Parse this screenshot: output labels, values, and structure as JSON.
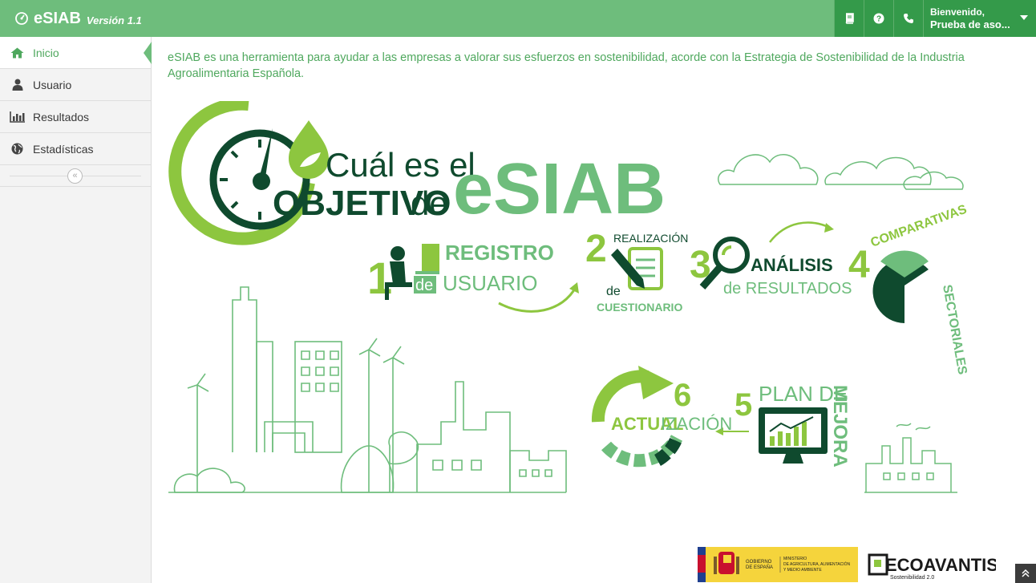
{
  "app": {
    "name": "eSIAB",
    "version": "Versión 1.1"
  },
  "header": {
    "welcome": "Bienvenido,",
    "user": "Prueba de aso...",
    "icons": [
      "book-icon",
      "help-icon",
      "phone-icon"
    ]
  },
  "sidebar": {
    "items": [
      {
        "label": "Inicio",
        "icon": "home-icon",
        "active": true
      },
      {
        "label": "Usuario",
        "icon": "user-icon",
        "active": false
      },
      {
        "label": "Resultados",
        "icon": "bar-chart-icon",
        "active": false
      },
      {
        "label": "Estadísticas",
        "icon": "globe-icon",
        "active": false
      }
    ],
    "collapse_icon": "«"
  },
  "main": {
    "intro": "eSIAB es una herramienta para ayudar a las empresas a valorar sus esfuerzos en sostenibilidad, acorde con la Estrategia de Sostenibilidad de la Industria Agroalimentaria Española."
  },
  "infographic": {
    "title_line1": "Cuál es el",
    "title_line2a": "OBJETIVO",
    "title_line2b": "de",
    "title_brand": "eSIAB",
    "steps": [
      {
        "num": "1",
        "text1": "REGISTRO",
        "text2": "de",
        "text3": "USUARIO"
      },
      {
        "num": "2",
        "text1": "REALIZACIÓN",
        "text2": "de",
        "text3": "CUESTIONARIO"
      },
      {
        "num": "3",
        "text1": "ANÁLISIS",
        "text2": "de RESULTADOS"
      },
      {
        "num": "4",
        "text1": "COMPARATIVAS",
        "text2": "SECTORIALES"
      },
      {
        "num": "5",
        "text1": "PLAN DE",
        "text2": "MEJORA"
      },
      {
        "num": "6",
        "text1": "ACTUAL",
        "text2": "IZACIÓN"
      }
    ]
  },
  "footer": {
    "gov1": "GOBIERNO",
    "gov2": "DE ESPAÑA",
    "min1": "MINISTERIO",
    "min2": "DE AGRICULTURA, ALIMENTACIÓN",
    "min3": "Y MEDIO AMBIENTE",
    "brand": "ECOAVANTIS",
    "brand_sub": "Sostenibilidad 2.0"
  },
  "colors": {
    "primary": "#6ebd7c",
    "dark_green": "#349a4a",
    "forest": "#0f4a2e",
    "lime": "#8dc63f"
  }
}
